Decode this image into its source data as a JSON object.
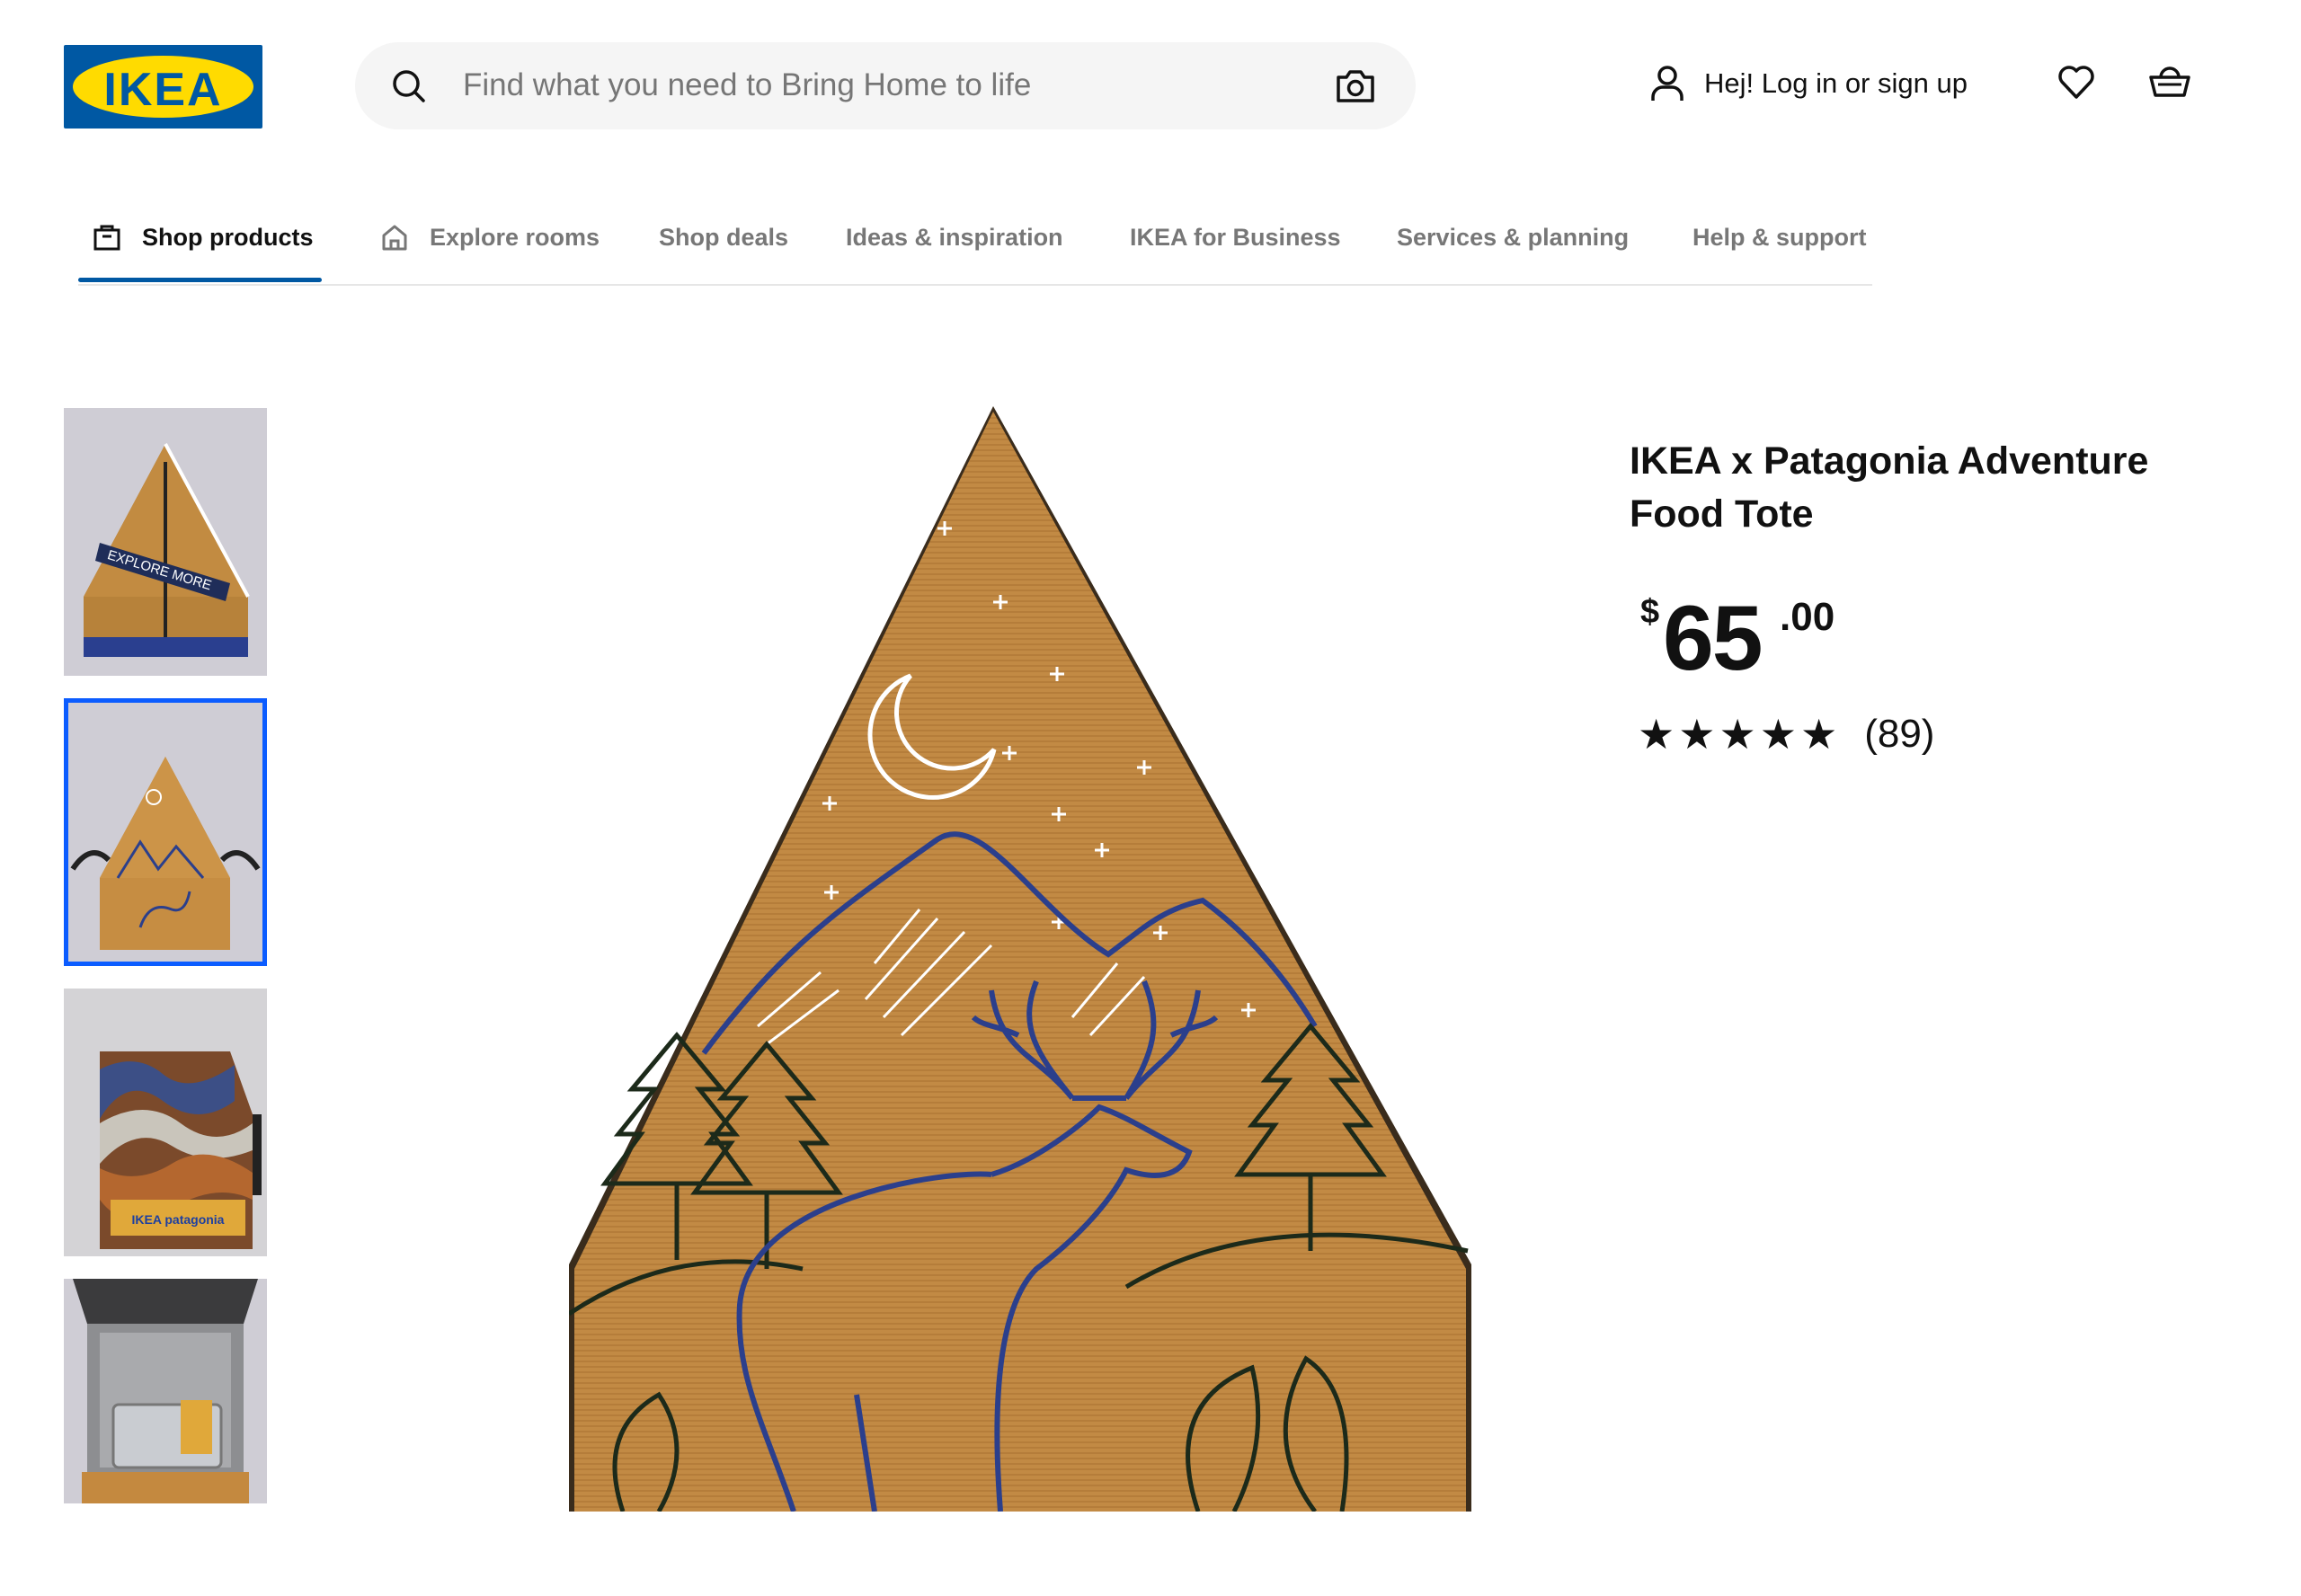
{
  "brand": {
    "logo_text": "IKEA",
    "primary_blue": "#0058a3",
    "primary_yellow": "#ffdb00"
  },
  "header": {
    "search": {
      "placeholder": "Find what you need to Bring Home to life",
      "icon": "search-icon",
      "camera_icon": "camera-icon"
    },
    "login_label": "Hej! Log in or sign up",
    "icons": [
      "user-icon",
      "heart-icon",
      "shopping-bag-icon"
    ]
  },
  "nav": {
    "items": [
      {
        "label": "Shop products",
        "active": true,
        "icon": "shopping-bag-icon"
      },
      {
        "label": "Explore rooms",
        "icon": "home-icon"
      },
      {
        "label": "Shop deals"
      },
      {
        "label": "Ideas & inspiration"
      },
      {
        "label": "IKEA for Business"
      },
      {
        "label": "Services & planning"
      },
      {
        "label": "Help & support"
      }
    ],
    "active_color": "#0058a3"
  },
  "gallery": {
    "thumbnails": [
      {
        "image": "tote-front-explore-more",
        "banner_text": "EXPLORE MORE"
      },
      {
        "image": "tote-deer-side",
        "selected": true
      },
      {
        "image": "tote-camo-pattern",
        "label_text": "IKEA patagonia"
      },
      {
        "image": "tote-open-interior"
      }
    ],
    "selected_color": "#0b5cff"
  },
  "product": {
    "title": "IKEA x Patagonia Adventure Food Tote",
    "price": {
      "currency": "$",
      "integer": "65",
      "decimal": ".00"
    },
    "rating": {
      "stars": "★★★★★",
      "value": 5,
      "max": 5,
      "count": "(89)"
    }
  }
}
